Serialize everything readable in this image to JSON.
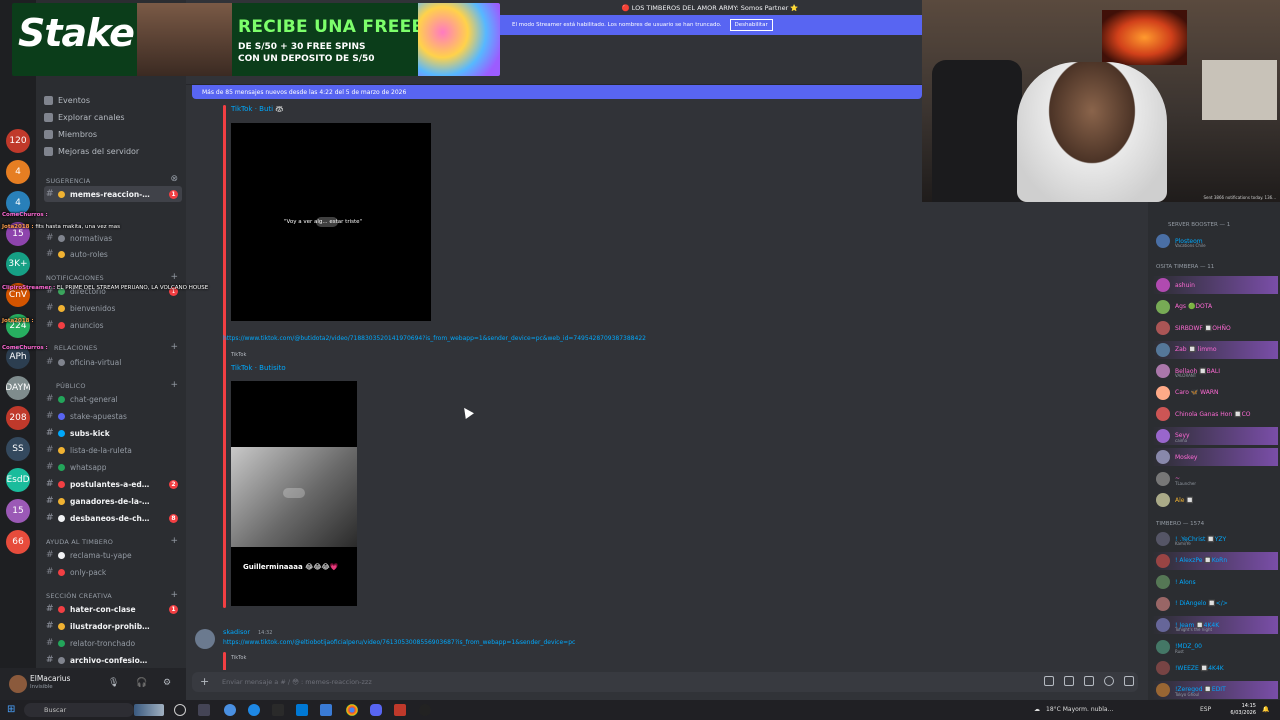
{
  "window": {
    "stream_title": "🔴 LOS TIMBEROS DEL AMOR ARMY: Somos Partner ⭐"
  },
  "streamer_mode": {
    "text": "El modo Streamer está habilitado. Los nombres de usuario se han truncado.",
    "button": "Deshabilitar"
  },
  "ad": {
    "logo": "Stake",
    "headline": "RECIBE UNA FREEBET",
    "sub1": "DE S/50 + 30 FREE SPINS",
    "sub2": "CON UN DEPOSITO DE S/50"
  },
  "server_rail": {
    "badges": [
      "120",
      "4",
      "4",
      "15",
      "3K+",
      "CnV",
      "224",
      "APh",
      "DAYM",
      "208",
      "SS",
      "EsdD",
      "15",
      "66"
    ]
  },
  "sidebar_menu": [
    {
      "label": "Eventos",
      "icon": "calendar-icon"
    },
    {
      "label": "Explorar canales",
      "icon": "compass-icon"
    },
    {
      "label": "Miembros",
      "icon": "members-icon"
    },
    {
      "label": "Mejoras del servidor",
      "icon": "boost-icon"
    }
  ],
  "categories": {
    "sugerencia": "Sugerencia",
    "notificaciones": "NOTIFICACIONES",
    "relaciones": "RELACIONES",
    "publico": "PÚBLICO",
    "ayuda": "AYUDA AL TIMBERO",
    "creativa": "SECCIÓN CREATIVA"
  },
  "channels": [
    {
      "name": "memes-reaccion-...",
      "active": true,
      "unread": true,
      "badge": "1",
      "color": "#f0b232"
    },
    {
      "name": "normativas",
      "color": "#80848e"
    },
    {
      "name": "auto-roles",
      "color": "#f0b232"
    },
    {
      "name": "directorio",
      "color": "#3ba55d",
      "badge": "1"
    },
    {
      "name": "bienvenidos",
      "color": "#f0b232"
    },
    {
      "name": "anuncios",
      "color": "#f23f43"
    },
    {
      "name": "oficina-virtual",
      "color": "#80848e"
    },
    {
      "name": "chat-general",
      "color": "#23a55a"
    },
    {
      "name": "stake-apuestas",
      "color": "#5865f2"
    },
    {
      "name": "subs-kick",
      "unread": true,
      "color": "#00a8fc"
    },
    {
      "name": "lista-de-la-ruleta",
      "color": "#f0b232"
    },
    {
      "name": "whatsapp",
      "color": "#23a55a"
    },
    {
      "name": "postulantes-a-edi...",
      "unread": true,
      "badge": "2",
      "color": "#f23f43"
    },
    {
      "name": "ganadores-de-la-ruleta",
      "unread": true,
      "color": "#f0b232"
    },
    {
      "name": "desbaneos-de-ch...",
      "unread": true,
      "badge": "8",
      "color": "#f2f3f5"
    },
    {
      "name": "reclama-tu-yape",
      "color": "#f2f3f5"
    },
    {
      "name": "only-pack",
      "color": "#f23f43"
    },
    {
      "name": "hater-con-clase",
      "unread": true,
      "badge": "1",
      "color": "#f23f43"
    },
    {
      "name": "ilustrador-prohibido",
      "unread": true,
      "color": "#f0b232"
    },
    {
      "name": "relator-tronchado",
      "color": "#23a55a"
    },
    {
      "name": "archivo-confesiones",
      "unread": true,
      "color": "#80848e"
    }
  ],
  "user_panel": {
    "name": "ElMacarius",
    "status": "Invisible"
  },
  "stream_overlay_chat": [
    {
      "user": "ComeChurros :",
      "text": "",
      "color": "#ff6ad5"
    },
    {
      "user": "Jota2018 :",
      "text": "fits hasta makita, una vez mas",
      "color": "#ff9e4a"
    },
    {
      "user": "ClipiroStreamer :",
      "text": "EL PRIME DEL STREAM PERUANO, LA VOLCANO HOUSE",
      "color": "#ff6ad5"
    },
    {
      "user": "Jota2018 :",
      "text": "",
      "color": "#ff9e4a"
    },
    {
      "user": "ComeChurros :",
      "text": "",
      "color": "#ff6ad5"
    }
  ],
  "chat": {
    "new_messages_banner": "Más de 85 mensajes nuevos desde las 4:22 del 5 de marzo de 2026",
    "embed1_title": "TikTok · Buti 🦝",
    "embed1_caption": "\"Voy a ver alg... estar triste\"",
    "link1": "https://www.tiktok.com/@butidota2/video/7188303520141970694?is_from_webapp=1&sender_device=pc&web_id=7495428709387388422",
    "embed2_provider": "TikTok",
    "embed2_title": "TikTok · Butisito",
    "embed2_caption": "Guillerminaaaa 😂😂😂💗",
    "author2": "skadisor",
    "time2": "14:32",
    "link2": "https://www.tiktok.com/@eltiobotijaoficialperu/video/7613053008556903687?is_from_webapp=1&sender_device=pc",
    "embed3_provider": "TikTok"
  },
  "composer": {
    "placeholder": "Enviar mensaje a # / 😳 : memes-reaccion-zzz"
  },
  "webcam": {
    "overlay_text": "Sent 3866 notifications today. 136..."
  },
  "members": {
    "cat1": "SERVER BOOSTER — 1",
    "cat2": "OSITA TIMBERA — 11",
    "cat3": "TIMBERO — 1574",
    "booster": [
      {
        "name": "Plosteom",
        "sub": "Vacations Chile",
        "color": "#00a8fc",
        "av": "#4a6fa5"
      }
    ],
    "osita": [
      {
        "name": "ashuin",
        "color": "#ff6ad5",
        "av": "#b04ab0",
        "hl": true
      },
      {
        "name": "Ags 🟢DOTA",
        "color": "#ff6ad5",
        "av": "#7a5",
        "hl": false
      },
      {
        "name": "SIRBDWF 🔲OHÑO",
        "color": "#ff6ad5",
        "av": "#a55",
        "hl": false
      },
      {
        "name": "Zab 🔲 limmo",
        "color": "#ff6ad5",
        "av": "#579",
        "hl": true
      },
      {
        "name": "Bellaoh 🔲BALI",
        "sub": "VALORANT",
        "color": "#ff6ad5",
        "av": "#a7a",
        "hl": false
      },
      {
        "name": "Caro 🦋 WARN",
        "color": "#ff6ad5",
        "av": "#fa8",
        "hl": false
      },
      {
        "name": "Chinola Ganas Hon 🔲CO",
        "color": "#ff6ad5",
        "av": "#c55",
        "hl": false
      },
      {
        "name": "Seyy",
        "sub": "caima",
        "color": "#ff6ad5",
        "av": "#96c",
        "hl": true
      },
      {
        "name": "Moskey",
        "color": "#ff6ad5",
        "av": "#88a",
        "hl": true
      },
      {
        "name": "~",
        "sub": "TLauncher",
        "color": "#ff6ad5",
        "av": "#777",
        "hl": false
      },
      {
        "name": "Ale 🔲",
        "color": "#f0b232",
        "av": "#aa8",
        "hl": false
      }
    ],
    "timbero": [
      {
        "name": "! .YeChrist 🔲YZY",
        "sub": "Kami/Ye",
        "color": "#00a8fc",
        "av": "#556"
      },
      {
        "name": "! AlexzPe 🔲KoRn",
        "color": "#00a8fc",
        "av": "#944",
        "hl": true
      },
      {
        "name": "! Alons",
        "color": "#00a8fc",
        "av": "#575"
      },
      {
        "name": "! DiAngelo 🔲</>",
        "color": "#00a8fc",
        "av": "#966"
      },
      {
        "name": "! Jeam 🔲4K4K",
        "sub": "Tonight's the night",
        "color": "#00a8fc",
        "av": "#669",
        "hl": true
      },
      {
        "name": "!MDZ_00",
        "sub": "Rust",
        "color": "#00a8fc",
        "av": "#476"
      },
      {
        "name": "!WEEZE 🔲4K4K",
        "color": "#00a8fc",
        "av": "#744"
      },
      {
        "name": "!Zeregod 🔲EDIT",
        "sub": "Tokyo Ghoul",
        "color": "#00a8fc",
        "av": "#963",
        "hl": true
      }
    ]
  },
  "taskbar": {
    "search": "Buscar",
    "weather": "18°C  Mayorm. nubla...",
    "lang": "ESP",
    "time": "14:15",
    "date": "6/03/2026"
  },
  "colors": {
    "accent": "#5865f2",
    "danger": "#f23f43",
    "link": "#00a8fc"
  }
}
